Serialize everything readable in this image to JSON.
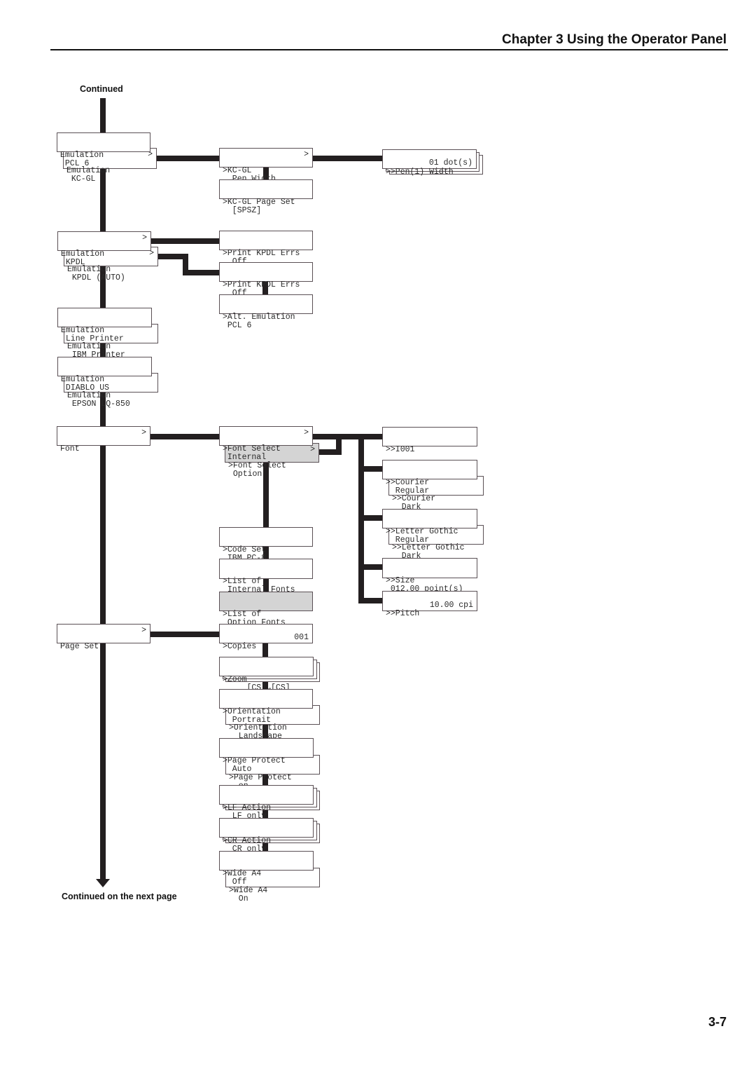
{
  "header": {
    "title": "Chapter 3  Using the Operator Panel"
  },
  "page_number": "3-7",
  "notes": {
    "continued": "Continued",
    "continued_next": "Continued on the next page"
  },
  "boxes": {
    "emu_pcl6": {
      "l1": "Emulation",
      "l2": " PCL 6",
      "arrow": ""
    },
    "emu_kcgl": {
      "l1": "Emulation",
      "l2": " KC-GL",
      "arrow": ">"
    },
    "kcgl_penwidth": {
      "l1": ">KC-GL",
      "l2": "  Pen Width",
      "arrow": ">"
    },
    "pen1_width": {
      "l1": ">>Pen(1) Width",
      "r2": "01 dot(s)"
    },
    "kcgl_pageset": {
      "l1": ">KC-GL Page Set",
      "l2": "  [SPSZ]"
    },
    "emu_kpdl": {
      "l1": "Emulation",
      "l2": " KPDL",
      "arrow": ">"
    },
    "emu_kpdl_auto": {
      "l1": "Emulation",
      "l2": " KPDL (AUTO)",
      "arrow": ">"
    },
    "print_kpdl_errs_1": {
      "l1": ">Print KPDL Errs",
      "l2": "  Off"
    },
    "print_kpdl_errs_2": {
      "l1": ">Print KPDL Errs",
      "l2": "  Off"
    },
    "alt_emulation": {
      "l1": ">Alt. Emulation",
      "l2": " PCL 6"
    },
    "emu_line_printer": {
      "l1": "Emulation",
      "l2": " Line Printer"
    },
    "emu_ibm_printer": {
      "l1": "Emulation",
      "l2": " IBM Printer"
    },
    "emu_diablo": {
      "l1": "Emulation",
      "l2": " DIABLO US"
    },
    "emu_epson": {
      "l1": "Emulation",
      "l2": " EPSON LQ-850"
    },
    "font": {
      "l1": "Font",
      "l2": "",
      "arrow": ">"
    },
    "font_select_internal": {
      "l1": ">Font Select",
      "l2": " Internal",
      "arrow": ">"
    },
    "font_select_option": {
      "l1": ">Font Select",
      "l2": " Option",
      "arrow": ">"
    },
    "i001": {
      "l1": ">>I001",
      "l2": ""
    },
    "courier_regular": {
      "l1": ">>Courier",
      "l2": "  Regular"
    },
    "courier_dark": {
      "l1": ">>Courier",
      "l2": "  Dark"
    },
    "letter_gothic_regular": {
      "l1": ">>Letter Gothic",
      "l2": "  Regular"
    },
    "letter_gothic_dark": {
      "l1": ">>Letter Gothic",
      "l2": "  Dark"
    },
    "code_set": {
      "l1": ">Code Set",
      "l2": " IBM PC-8"
    },
    "list_internal_fonts": {
      "l1": ">List of",
      "l2": " Internal Fonts"
    },
    "list_option_fonts": {
      "l1": ">List of",
      "l2": " Option Fonts"
    },
    "size": {
      "l1": ">>Size",
      "l2": " 012.00 point(s)"
    },
    "pitch": {
      "l1": ">>Pitch",
      "r2": "10.00 cpi"
    },
    "page_set": {
      "l1": "Page Set",
      "l2": "",
      "arrow": ">"
    },
    "copies": {
      "l1": ">Copies",
      "r2": "001"
    },
    "zoom": {
      "l1": ">Zoom",
      "l2": "     [CS]→[CS]"
    },
    "orientation_portrait": {
      "l1": ">Orientation",
      "l2": "  Portrait"
    },
    "orientation_landscape": {
      "l1": ">Orientation",
      "l2": "  Landscape"
    },
    "page_protect_auto": {
      "l1": ">Page Protect",
      "l2": "  Auto"
    },
    "page_protect_on": {
      "l1": ">Page Protect",
      "l2": "  on"
    },
    "lf_action": {
      "l1": ">LF Action",
      "l2": "  LF only"
    },
    "cr_action": {
      "l1": ">CR Action",
      "l2": "  CR only"
    },
    "wide_a4_off": {
      "l1": ">Wide A4",
      "l2": "  Off"
    },
    "wide_a4_on": {
      "l1": ">Wide A4",
      "l2": "  On"
    }
  }
}
